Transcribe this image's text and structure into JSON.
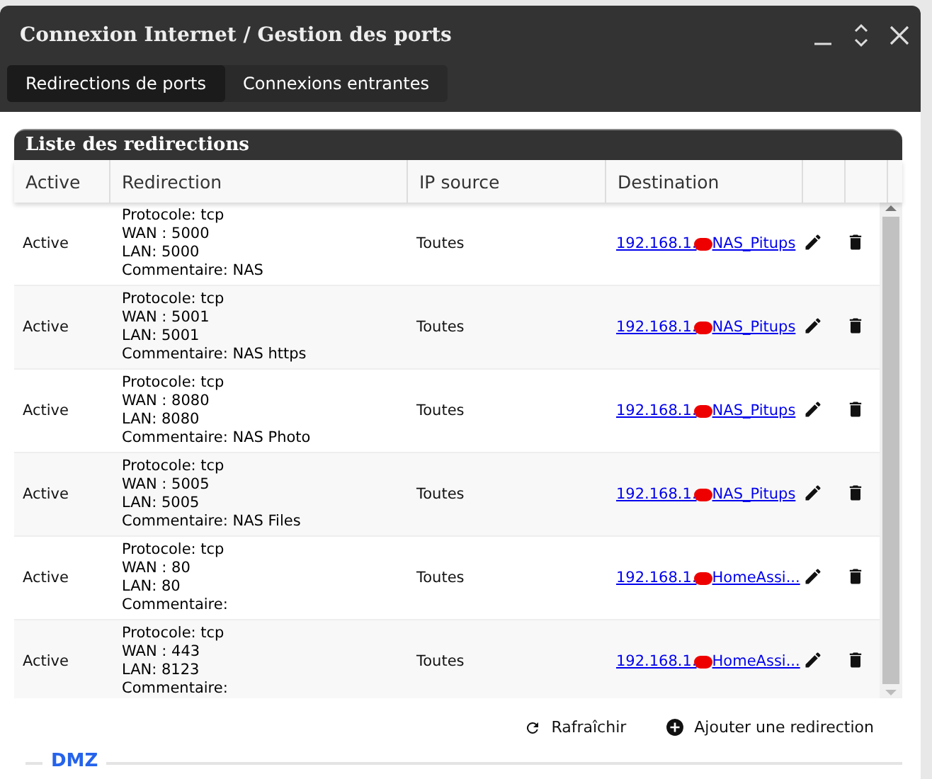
{
  "window": {
    "title": "Connexion Internet / Gestion des ports"
  },
  "tabs": [
    {
      "label": "Redirections de ports",
      "selected": true
    },
    {
      "label": "Connexions entrantes",
      "selected": false
    }
  ],
  "panel": {
    "title": "Liste des redirections"
  },
  "table": {
    "columns": [
      "Active",
      "Redirection",
      "IP source",
      "Destination"
    ],
    "rows": [
      {
        "active": "Active",
        "redirection": [
          "Protocole: tcp",
          "WAN : 5000",
          "LAN: 5000",
          "Commentaire: NAS"
        ],
        "ip_source": "Toutes",
        "destination_prefix": "192.168.1.",
        "destination_host": "NAS_Pitups"
      },
      {
        "active": "Active",
        "redirection": [
          "Protocole: tcp",
          "WAN : 5001",
          "LAN: 5001",
          "Commentaire: NAS https"
        ],
        "ip_source": "Toutes",
        "destination_prefix": "192.168.1.",
        "destination_host": "NAS_Pitups"
      },
      {
        "active": "Active",
        "redirection": [
          "Protocole: tcp",
          "WAN : 8080",
          "LAN: 8080",
          "Commentaire: NAS Photo"
        ],
        "ip_source": "Toutes",
        "destination_prefix": "192.168.1.",
        "destination_host": "NAS_Pitups"
      },
      {
        "active": "Active",
        "redirection": [
          "Protocole: tcp",
          "WAN : 5005",
          "LAN: 5005",
          "Commentaire: NAS Files"
        ],
        "ip_source": "Toutes",
        "destination_prefix": "192.168.1.",
        "destination_host": "NAS_Pitups"
      },
      {
        "active": "Active",
        "redirection": [
          "Protocole: tcp",
          "WAN : 80",
          "LAN: 80",
          "Commentaire:"
        ],
        "ip_source": "Toutes",
        "destination_prefix": "192.168.1.",
        "destination_host": "HomeAssi..."
      },
      {
        "active": "Active",
        "redirection": [
          "Protocole: tcp",
          "WAN : 443",
          "LAN: 8123",
          "Commentaire:"
        ],
        "ip_source": "Toutes",
        "destination_prefix": "192.168.1.",
        "destination_host": "HomeAssi..."
      }
    ]
  },
  "actions": [
    {
      "kind": "refresh",
      "label": "Rafraîchir"
    },
    {
      "kind": "add",
      "label": "Ajouter une redirection"
    }
  ],
  "next_section": {
    "title": "DMZ"
  }
}
